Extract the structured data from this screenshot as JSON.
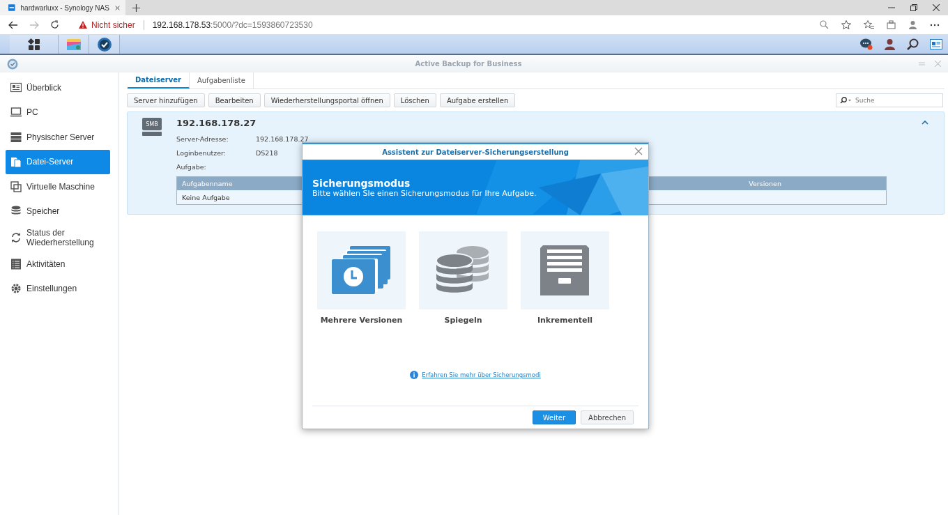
{
  "browser": {
    "tab_title": "hardwarluxx - Synology NAS",
    "security": "Nicht sicher",
    "address_host": "192.168.178.53",
    "address_rest": ":5000/?dc=1593860723530"
  },
  "app": {
    "title": "Active Backup for Business",
    "sidebar": {
      "items": [
        {
          "label": "Überblick",
          "selected": false
        },
        {
          "label": "PC",
          "selected": false
        },
        {
          "label": "Physischer Server",
          "selected": false
        },
        {
          "label": "Datei-Server",
          "selected": true
        },
        {
          "label": "Virtuelle Maschine",
          "selected": false
        },
        {
          "label": "Speicher",
          "selected": false
        },
        {
          "label": "Status der Wiederherstellung",
          "selected": false
        },
        {
          "label": "Aktivitäten",
          "selected": false
        },
        {
          "label": "Einstellungen",
          "selected": false
        }
      ]
    },
    "tabs": [
      {
        "label": "Dateiserver",
        "selected": true
      },
      {
        "label": "Aufgabenliste",
        "selected": false
      }
    ],
    "toolbar": [
      "Server hinzufügen",
      "Bearbeiten",
      "Wiederherstellungsportal öffnen",
      "Löschen",
      "Aufgabe erstellen"
    ],
    "search": {
      "placeholder": "Suche"
    },
    "server": {
      "badge": "SMB",
      "title": "192.168.178.27",
      "expanded": true,
      "fields": [
        {
          "label": "Server-Adresse:",
          "value": "192.168.178.27"
        },
        {
          "label": "Loginbenutzer:",
          "value": "DS218"
        },
        {
          "label": "Aufgabe:"
        }
      ],
      "table": {
        "columns": [
          "Aufgabenname",
          "Versionen"
        ],
        "rows": [
          [
            "Keine Aufgabe"
          ]
        ]
      }
    }
  },
  "dialog": {
    "title": "Assistent zur Dateiserver-Sicherungserstellung",
    "heading": "Sicherungsmodus",
    "subtitle": "Bitte wählen SIe einen Sicherungsmodus für Ihre Aufgabe.",
    "options": [
      {
        "label": "Mehrere Versionen",
        "kind": "versions"
      },
      {
        "label": "Spiegeln",
        "kind": "mirror"
      },
      {
        "label": "Inkrementell",
        "kind": "incremental"
      }
    ],
    "link": "Erfahren Sie mehr über Sicherungsmodi",
    "buttons": [
      {
        "label": "Weiter",
        "kind": "primary"
      },
      {
        "label": "Abbrechen",
        "kind": "secondary"
      }
    ]
  }
}
